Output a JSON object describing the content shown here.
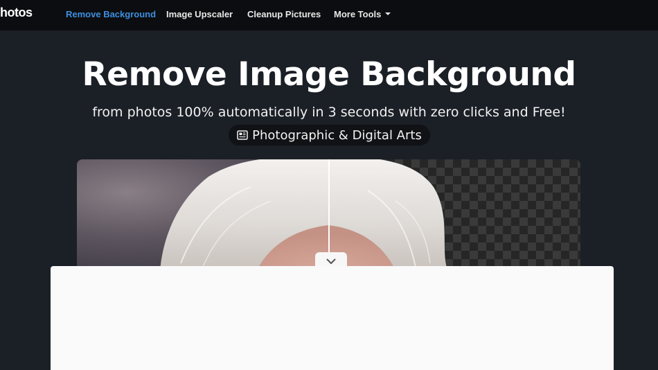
{
  "brand": {
    "name": "hotos"
  },
  "nav": {
    "items": [
      {
        "label": "Remove Background",
        "active": true
      },
      {
        "label": "Image Upscaler",
        "active": false
      },
      {
        "label": "Cleanup Pictures",
        "active": false
      },
      {
        "label": "More Tools",
        "active": false,
        "dropdown": true
      }
    ]
  },
  "hero": {
    "title": "Remove Image Background",
    "subtitle": "from photos 100% automatically in 3 seconds with zero clicks and Free!",
    "category": "Photographic & Digital Arts",
    "category_icon": "newspaper-icon"
  },
  "compare": {
    "before_image": "portrait-with-background",
    "after_image": "portrait-transparent-background",
    "handle_icon": "chevron-down-icon"
  },
  "colors": {
    "nav_bg": "#0c0d10",
    "page_bg": "#1b1f26",
    "accent": "#3d8fe0",
    "panel_bg": "#fafafa"
  }
}
